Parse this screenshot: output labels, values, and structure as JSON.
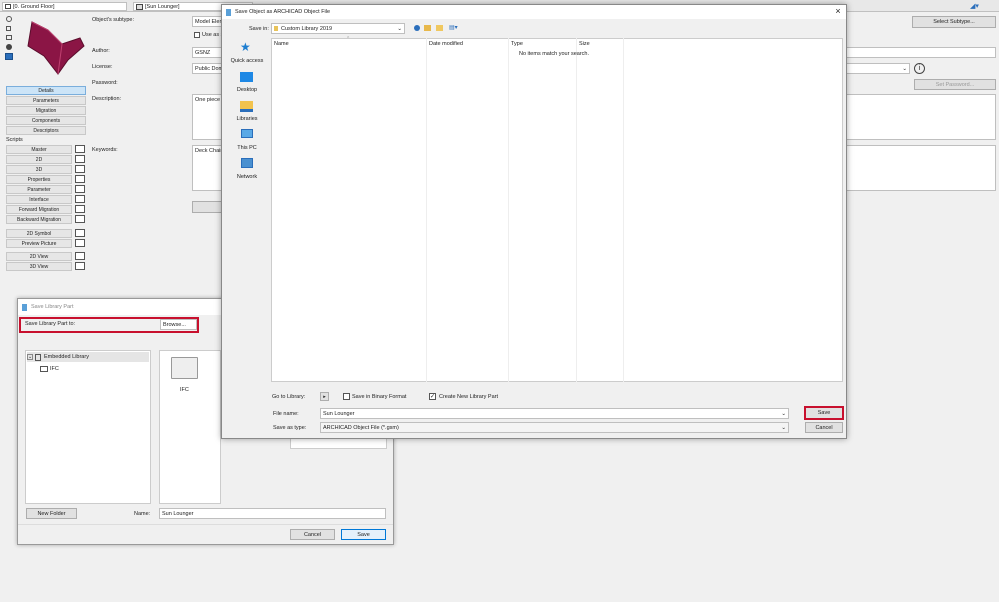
{
  "topbar": {
    "view_label": "[0. Ground Floor]",
    "tab_label": "[Sun Lounger]"
  },
  "editor": {
    "subtype_label": "Object's subtype:",
    "subtype_value": "Model Elem",
    "use_as_label": "Use as su",
    "select_subtype": "Select Subtype...",
    "author_label": "Author:",
    "author_value": "GSNZ",
    "license_label": "License:",
    "license_value": "Public Dom",
    "password_label": "Password:",
    "set_password": "Set Password...",
    "description_label": "Description:",
    "description_value": "One piece r",
    "keywords_label": "Keywords:",
    "keywords_value": "Deck Chair"
  },
  "sidebar": {
    "items": [
      "Details",
      "Parameters",
      "Migration",
      "Components",
      "Descriptors"
    ],
    "scripts_title": "Scripts",
    "scripts": [
      "Master",
      "2D",
      "3D",
      "Properties",
      "Parameter",
      "Interface",
      "Forward Migration",
      "Backward Migration"
    ],
    "extras": [
      "2D Symbol",
      "Preview Picture",
      "2D View",
      "3D View"
    ]
  },
  "library_dialog": {
    "title": "Save Library Part",
    "save_to_label": "Save Library Part to:",
    "browse_label": "Browse...",
    "tree_root": "Embedded Library",
    "tree_child": "IFC",
    "folder_label": "IFC",
    "new_folder": "New Folder",
    "name_label": "Name:",
    "name_value": "Sun Lounger",
    "cancel": "Cancel",
    "save": "Save"
  },
  "save_dialog": {
    "title": "Save Object as ARCHICAD Object File",
    "save_in_label": "Save in:",
    "save_in_value": "Custom Library 2019",
    "nav": [
      "Quick access",
      "Desktop",
      "Libraries",
      "This PC",
      "Network"
    ],
    "columns": [
      "Name",
      "Date modified",
      "Type",
      "Size"
    ],
    "empty_message": "No items match your search.",
    "goto_label": "Go to Library:",
    "binary_label": "Save in Binary Format",
    "create_new_label": "Create New Library Part",
    "file_name_label": "File name:",
    "file_name_value": "Sun Lounger",
    "save_type_label": "Save as type:",
    "save_type_value": "ARCHICAD Object File (*.gsm)",
    "save": "Save",
    "cancel": "Cancel"
  },
  "colors": {
    "accent_red": "#c8102e",
    "object_preview": "#8b1545",
    "selected_blue": "#cce4f7"
  }
}
